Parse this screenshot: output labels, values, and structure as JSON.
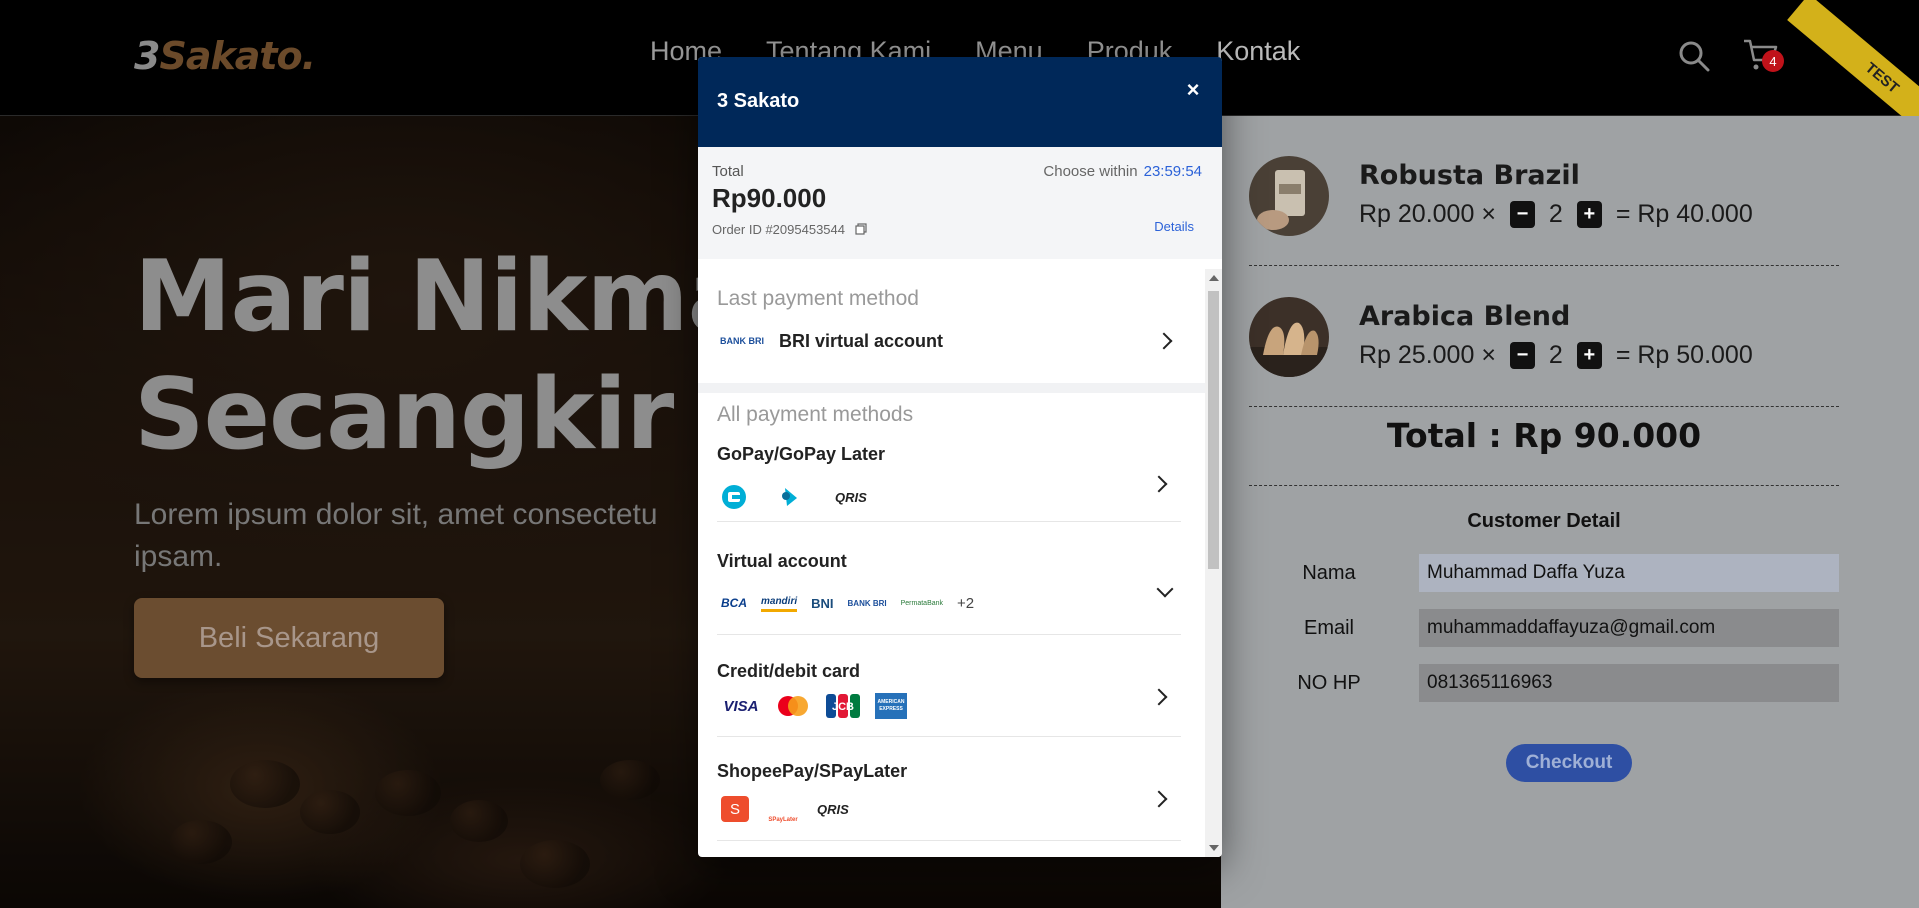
{
  "nav": {
    "logo_main": "3",
    "logo_accent": "Sakato",
    "logo_dot": ".",
    "links": [
      "Home",
      "Tentang Kami",
      "Menu",
      "Produk",
      "Kontak"
    ],
    "cart_count": "4",
    "ribbon": "TEST"
  },
  "hero": {
    "title_line1": "Mari Nikma",
    "title_line2": "Secangkir K",
    "desc_line1": "Lorem ipsum dolor sit, amet consectetu",
    "desc_line2": "ipsam.",
    "cta": "Beli Sekarang"
  },
  "cart": {
    "items": [
      {
        "name": "Robusta Brazil",
        "price": "Rp 20.000 ×",
        "qty": "2",
        "subtotal": "= Rp 40.000",
        "minus": "−",
        "plus": "+"
      },
      {
        "name": "Arabica Blend",
        "price": "Rp 25.000 ×",
        "qty": "2",
        "subtotal": "= Rp 50.000",
        "minus": "−",
        "plus": "+"
      }
    ],
    "total": "Total : Rp 90.000",
    "customer_title": "Customer Detail",
    "fields": [
      {
        "label": "Nama",
        "value": "Muhammad Daffa Yuza"
      },
      {
        "label": "Email",
        "value": "muhammaddaffayuza@gmail.com"
      },
      {
        "label": "NO HP",
        "value": "081365116963"
      }
    ],
    "checkout": "Checkout"
  },
  "modal": {
    "title": "3 Sakato",
    "close": "×",
    "total_label": "Total",
    "amount": "Rp90.000",
    "order_id": "Order ID #2095453544",
    "choose_within": "Choose within",
    "timer": "23:59:54",
    "details": "Details",
    "last_title": "Last payment method",
    "last_method": "BRI virtual account",
    "last_logo": "BANK BRI",
    "all_title": "All payment methods",
    "methods": [
      {
        "name": "GoPay/GoPay Later",
        "logos": [
          "gopay",
          "gopaylater",
          "QRIS"
        ],
        "more": ""
      },
      {
        "name": "Virtual account",
        "logos": [
          "BCA",
          "mandiri",
          "BNI",
          "BANK BRI",
          "PermataBank"
        ],
        "more": "+2"
      },
      {
        "name": "Credit/debit card",
        "logos": [
          "VISA",
          "mastercard",
          "JCB",
          "AMERICAN EXPRESS"
        ],
        "more": ""
      },
      {
        "name": "ShopeePay/SPayLater",
        "logos": [
          "S",
          "SPayLater",
          "QRIS"
        ],
        "more": ""
      }
    ]
  },
  "colors": {
    "modal_header": "#002859",
    "link_blue": "#2c62d8",
    "checkout_btn": "#2e4fa3",
    "ribbon": "#d3b11a",
    "badge": "#c0121a"
  }
}
